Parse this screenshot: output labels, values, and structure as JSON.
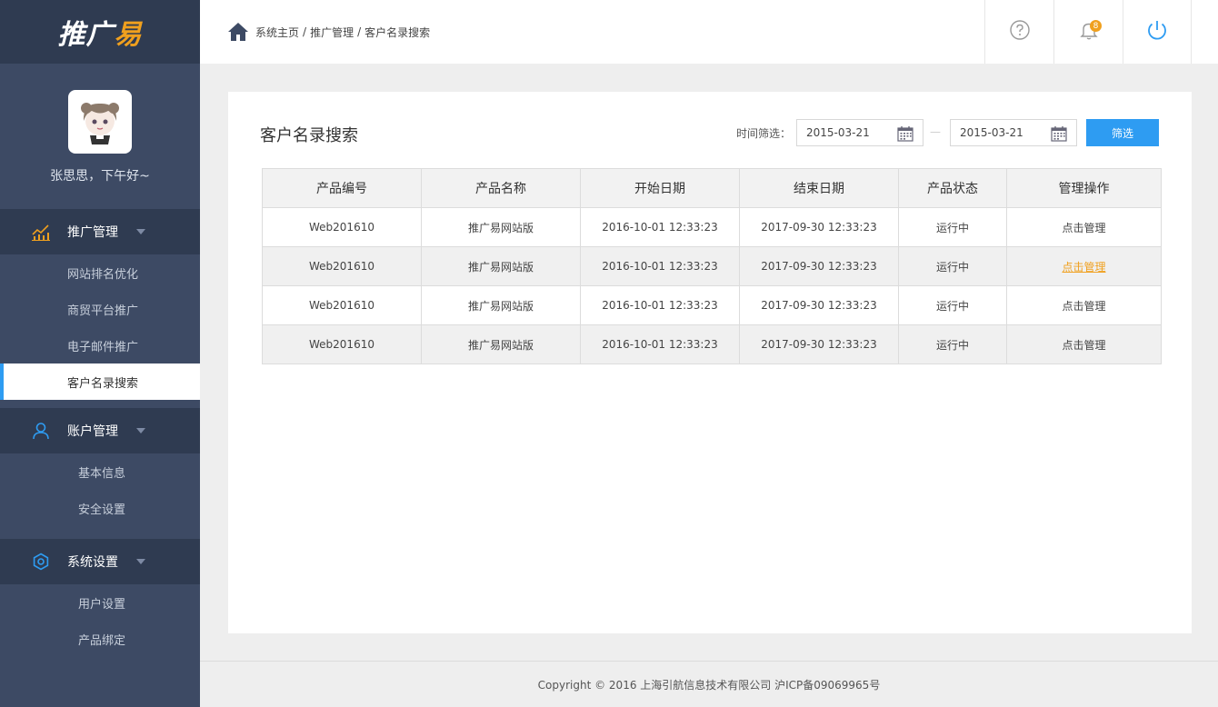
{
  "app": {
    "logo_main": "推广",
    "logo_accent": "易"
  },
  "profile": {
    "greeting": "张思思，下午好~"
  },
  "sidebar": {
    "groups": [
      {
        "label": "推广管理",
        "icon": "chart-icon",
        "items": [
          "网站排名优化",
          "商贸平台推广",
          "电子邮件推广",
          "客户名录搜索"
        ],
        "active_index": 3
      },
      {
        "label": "账户管理",
        "icon": "user-icon",
        "items": [
          "基本信息",
          "安全设置"
        ]
      },
      {
        "label": "系统设置",
        "icon": "gear-icon",
        "items": [
          "用户设置",
          "产品绑定"
        ]
      }
    ]
  },
  "header": {
    "breadcrumb": [
      "系统主页",
      "推广管理",
      "客户名录搜索"
    ],
    "notification_count": "8",
    "icons": [
      "help-icon",
      "bell-icon",
      "power-icon"
    ]
  },
  "main": {
    "title": "客户名录搜索",
    "filter_label": "时间筛选：",
    "date_from": "2015-03-21",
    "date_to": "2015-03-21",
    "dash": "—",
    "filter_button": "筛选",
    "table": {
      "columns": [
        "产品编号",
        "产品名称",
        "开始日期",
        "结束日期",
        "产品状态",
        "管理操作"
      ],
      "rows": [
        [
          "Web201610",
          "推广易网站版",
          "2016-10-01 12:33:23",
          "2017-09-30 12:33:23",
          "运行中",
          "点击管理"
        ],
        [
          "Web201610",
          "推广易网站版",
          "2016-10-01 12:33:23",
          "2017-09-30 12:33:23",
          "运行中",
          "点击管理"
        ],
        [
          "Web201610",
          "推广易网站版",
          "2016-10-01 12:33:23",
          "2017-09-30 12:33:23",
          "运行中",
          "点击管理"
        ],
        [
          "Web201610",
          "推广易网站版",
          "2016-10-01 12:33:23",
          "2017-09-30 12:33:23",
          "运行中",
          "点击管理"
        ]
      ],
      "highlight_row": 1
    }
  },
  "footer": {
    "text": "Copyright © 2016 上海引航信息技术有限公司  沪ICP备09069965号"
  },
  "colors": {
    "sidebar": "#3d4a64",
    "sidebar_dark": "#2f3b51",
    "accent": "#2e9cf2",
    "orange": "#f0a01e"
  }
}
